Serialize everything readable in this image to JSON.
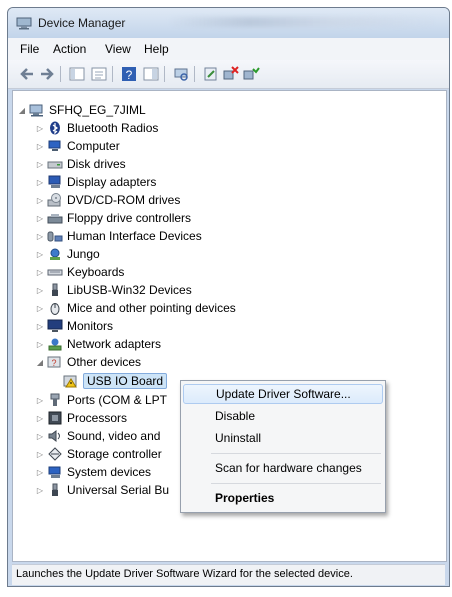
{
  "window": {
    "title": "Device Manager"
  },
  "menu": {
    "items": [
      "File",
      "Action",
      "View",
      "Help"
    ]
  },
  "toolbar": {
    "icons": [
      "back-arrow-icon",
      "forward-arrow-icon",
      "console-tree-icon",
      "properties-view-icon",
      "help-icon",
      "action-pane-icon",
      "scan-hardware-icon",
      "update-driver-icon",
      "uninstall-icon",
      "enable-icon"
    ]
  },
  "tree": {
    "root": "SFHQ_EG_7JIML",
    "items": [
      "Bluetooth Radios",
      "Computer",
      "Disk drives",
      "Display adapters",
      "DVD/CD-ROM drives",
      "Floppy drive controllers",
      "Human Interface Devices",
      "Jungo",
      "Keyboards",
      "LibUSB-Win32 Devices",
      "Mice and other pointing devices",
      "Monitors",
      "Network adapters",
      "Other devices",
      "USB IO Board",
      "Ports (COM & LPT",
      "Processors",
      "Sound, video and",
      "Storage controller",
      "System devices",
      "Universal Serial Bu"
    ]
  },
  "context_menu": {
    "update_driver": "Update Driver Software...",
    "disable": "Disable",
    "uninstall": "Uninstall",
    "scan": "Scan for hardware changes",
    "properties": "Properties"
  },
  "status": {
    "text": "Launches the Update Driver Software Wizard for the selected device."
  }
}
